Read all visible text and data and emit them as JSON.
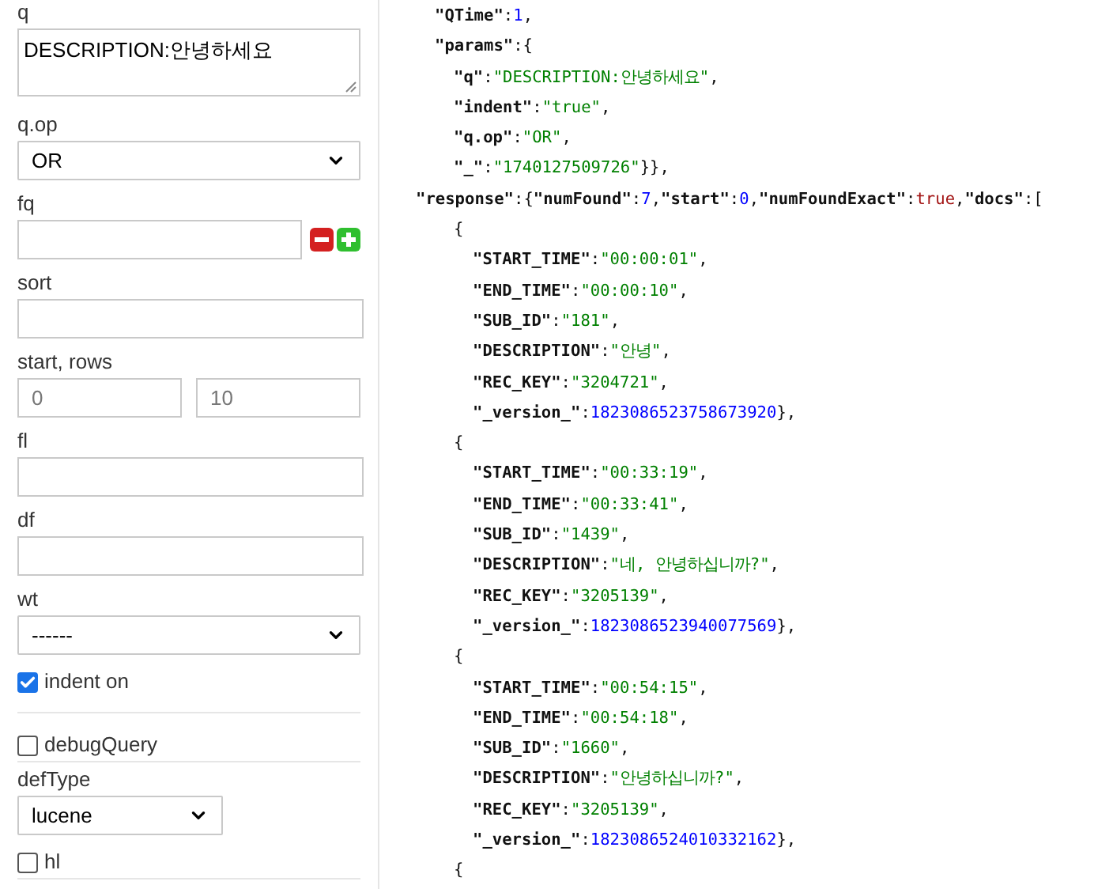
{
  "form": {
    "fields": [
      {
        "kind": "textarea",
        "label": "q",
        "value": "DESCRIPTION:안녕하세요"
      },
      {
        "kind": "select",
        "label": "q.op",
        "value": "OR",
        "wide": true
      },
      {
        "kind": "filter",
        "label": "fq"
      },
      {
        "kind": "input",
        "label": "sort"
      },
      {
        "kind": "pair",
        "label": "start, rows",
        "values": [
          "0",
          "10"
        ]
      },
      {
        "kind": "input",
        "label": "fl"
      },
      {
        "kind": "input",
        "label": "df"
      },
      {
        "kind": "select",
        "label": "wt",
        "value": "------",
        "wide": true
      },
      {
        "kind": "checkbox",
        "label": "indent on",
        "checked": true
      },
      {
        "kind": "checkbox",
        "label": "debugQuery",
        "checked": false
      },
      {
        "kind": "select",
        "label": "defType",
        "value": "lucene",
        "wide": false
      },
      {
        "kind": "checkbox",
        "label": "hl",
        "checked": false
      }
    ]
  },
  "response_view": {
    "lines": [
      {
        "children": [
          {
            "tokens": [
              {
                "kind": "key",
                "text": "\"QTime\""
              },
              {
                "kind": "punct",
                "text": ":"
              },
              {
                "kind": "number",
                "text": "1"
              },
              {
                "kind": "punct",
                "text": ","
              }
            ]
          },
          {
            "tokens": [
              {
                "kind": "key",
                "text": "\"params\""
              },
              {
                "kind": "punct",
                "text": ":{"
              }
            ],
            "children": [
              {
                "tokens": [
                  {
                    "kind": "key",
                    "text": "\"q\""
                  },
                  {
                    "kind": "punct",
                    "text": ":"
                  },
                  {
                    "kind": "string",
                    "text": "\"DESCRIPTION:안녕하세요\""
                  },
                  {
                    "kind": "punct",
                    "text": ","
                  }
                ]
              },
              {
                "tokens": [
                  {
                    "kind": "key",
                    "text": "\"indent\""
                  },
                  {
                    "kind": "punct",
                    "text": ":"
                  },
                  {
                    "kind": "string",
                    "text": "\"true\""
                  },
                  {
                    "kind": "punct",
                    "text": ","
                  }
                ]
              },
              {
                "tokens": [
                  {
                    "kind": "key",
                    "text": "\"q.op\""
                  },
                  {
                    "kind": "punct",
                    "text": ":"
                  },
                  {
                    "kind": "string",
                    "text": "\"OR\""
                  },
                  {
                    "kind": "punct",
                    "text": ","
                  }
                ]
              },
              {
                "tokens": [
                  {
                    "kind": "key",
                    "text": "\"_\""
                  },
                  {
                    "kind": "punct",
                    "text": ":"
                  },
                  {
                    "kind": "string",
                    "text": "\"1740127509726\""
                  },
                  {
                    "kind": "punct",
                    "text": "}},"
                  }
                ]
              }
            ]
          }
        ]
      },
      {
        "tokens": [
          {
            "kind": "key",
            "text": "\"response\""
          },
          {
            "kind": "punct",
            "text": ":{"
          },
          {
            "kind": "key",
            "text": "\"numFound\""
          },
          {
            "kind": "punct",
            "text": ":"
          },
          {
            "kind": "number",
            "text": "7"
          },
          {
            "kind": "punct",
            "text": ","
          },
          {
            "kind": "key",
            "text": "\"start\""
          },
          {
            "kind": "punct",
            "text": ":"
          },
          {
            "kind": "number",
            "text": "0"
          },
          {
            "kind": "punct",
            "text": ","
          },
          {
            "kind": "key",
            "text": "\"numFoundExact\""
          },
          {
            "kind": "punct",
            "text": ":"
          },
          {
            "kind": "bool",
            "text": "true"
          },
          {
            "kind": "punct",
            "text": ","
          },
          {
            "kind": "key",
            "text": "\"docs\""
          },
          {
            "kind": "punct",
            "text": ":["
          }
        ],
        "children": [
          {
            "children": [
              {
                "tokens": [
                  {
                    "kind": "punct",
                    "text": "{"
                  }
                ],
                "children": [
                  {
                    "tokens": [
                      {
                        "kind": "key",
                        "text": "\"START_TIME\""
                      },
                      {
                        "kind": "punct",
                        "text": ":"
                      },
                      {
                        "kind": "string",
                        "text": "\"00:00:01\""
                      },
                      {
                        "kind": "punct",
                        "text": ","
                      }
                    ]
                  },
                  {
                    "tokens": [
                      {
                        "kind": "key",
                        "text": "\"END_TIME\""
                      },
                      {
                        "kind": "punct",
                        "text": ":"
                      },
                      {
                        "kind": "string",
                        "text": "\"00:00:10\""
                      },
                      {
                        "kind": "punct",
                        "text": ","
                      }
                    ]
                  },
                  {
                    "tokens": [
                      {
                        "kind": "key",
                        "text": "\"SUB_ID\""
                      },
                      {
                        "kind": "punct",
                        "text": ":"
                      },
                      {
                        "kind": "string",
                        "text": "\"181\""
                      },
                      {
                        "kind": "punct",
                        "text": ","
                      }
                    ]
                  },
                  {
                    "tokens": [
                      {
                        "kind": "key",
                        "text": "\"DESCRIPTION\""
                      },
                      {
                        "kind": "punct",
                        "text": ":"
                      },
                      {
                        "kind": "string",
                        "text": "\"안녕\""
                      },
                      {
                        "kind": "punct",
                        "text": ","
                      }
                    ]
                  },
                  {
                    "tokens": [
                      {
                        "kind": "key",
                        "text": "\"REC_KEY\""
                      },
                      {
                        "kind": "punct",
                        "text": ":"
                      },
                      {
                        "kind": "string",
                        "text": "\"3204721\""
                      },
                      {
                        "kind": "punct",
                        "text": ","
                      }
                    ]
                  },
                  {
                    "tokens": [
                      {
                        "kind": "key",
                        "text": "\"_version_\""
                      },
                      {
                        "kind": "punct",
                        "text": ":"
                      },
                      {
                        "kind": "number",
                        "text": "1823086523758673920"
                      },
                      {
                        "kind": "punct",
                        "text": "},"
                      }
                    ]
                  }
                ]
              },
              {
                "tokens": [
                  {
                    "kind": "punct",
                    "text": "{"
                  }
                ],
                "children": [
                  {
                    "tokens": [
                      {
                        "kind": "key",
                        "text": "\"START_TIME\""
                      },
                      {
                        "kind": "punct",
                        "text": ":"
                      },
                      {
                        "kind": "string",
                        "text": "\"00:33:19\""
                      },
                      {
                        "kind": "punct",
                        "text": ","
                      }
                    ]
                  },
                  {
                    "tokens": [
                      {
                        "kind": "key",
                        "text": "\"END_TIME\""
                      },
                      {
                        "kind": "punct",
                        "text": ":"
                      },
                      {
                        "kind": "string",
                        "text": "\"00:33:41\""
                      },
                      {
                        "kind": "punct",
                        "text": ","
                      }
                    ]
                  },
                  {
                    "tokens": [
                      {
                        "kind": "key",
                        "text": "\"SUB_ID\""
                      },
                      {
                        "kind": "punct",
                        "text": ":"
                      },
                      {
                        "kind": "string",
                        "text": "\"1439\""
                      },
                      {
                        "kind": "punct",
                        "text": ","
                      }
                    ]
                  },
                  {
                    "tokens": [
                      {
                        "kind": "key",
                        "text": "\"DESCRIPTION\""
                      },
                      {
                        "kind": "punct",
                        "text": ":"
                      },
                      {
                        "kind": "string",
                        "text": "\"네, 안녕하십니까?\""
                      },
                      {
                        "kind": "punct",
                        "text": ","
                      }
                    ]
                  },
                  {
                    "tokens": [
                      {
                        "kind": "key",
                        "text": "\"REC_KEY\""
                      },
                      {
                        "kind": "punct",
                        "text": ":"
                      },
                      {
                        "kind": "string",
                        "text": "\"3205139\""
                      },
                      {
                        "kind": "punct",
                        "text": ","
                      }
                    ]
                  },
                  {
                    "tokens": [
                      {
                        "kind": "key",
                        "text": "\"_version_\""
                      },
                      {
                        "kind": "punct",
                        "text": ":"
                      },
                      {
                        "kind": "number",
                        "text": "1823086523940077569"
                      },
                      {
                        "kind": "punct",
                        "text": "},"
                      }
                    ]
                  }
                ]
              },
              {
                "tokens": [
                  {
                    "kind": "punct",
                    "text": "{"
                  }
                ],
                "children": [
                  {
                    "tokens": [
                      {
                        "kind": "key",
                        "text": "\"START_TIME\""
                      },
                      {
                        "kind": "punct",
                        "text": ":"
                      },
                      {
                        "kind": "string",
                        "text": "\"00:54:15\""
                      },
                      {
                        "kind": "punct",
                        "text": ","
                      }
                    ]
                  },
                  {
                    "tokens": [
                      {
                        "kind": "key",
                        "text": "\"END_TIME\""
                      },
                      {
                        "kind": "punct",
                        "text": ":"
                      },
                      {
                        "kind": "string",
                        "text": "\"00:54:18\""
                      },
                      {
                        "kind": "punct",
                        "text": ","
                      }
                    ]
                  },
                  {
                    "tokens": [
                      {
                        "kind": "key",
                        "text": "\"SUB_ID\""
                      },
                      {
                        "kind": "punct",
                        "text": ":"
                      },
                      {
                        "kind": "string",
                        "text": "\"1660\""
                      },
                      {
                        "kind": "punct",
                        "text": ","
                      }
                    ]
                  },
                  {
                    "tokens": [
                      {
                        "kind": "key",
                        "text": "\"DESCRIPTION\""
                      },
                      {
                        "kind": "punct",
                        "text": ":"
                      },
                      {
                        "kind": "string",
                        "text": "\"안녕하십니까?\""
                      },
                      {
                        "kind": "punct",
                        "text": ","
                      }
                    ]
                  },
                  {
                    "tokens": [
                      {
                        "kind": "key",
                        "text": "\"REC_KEY\""
                      },
                      {
                        "kind": "punct",
                        "text": ":"
                      },
                      {
                        "kind": "string",
                        "text": "\"3205139\""
                      },
                      {
                        "kind": "punct",
                        "text": ","
                      }
                    ]
                  },
                  {
                    "tokens": [
                      {
                        "kind": "key",
                        "text": "\"_version_\""
                      },
                      {
                        "kind": "punct",
                        "text": ":"
                      },
                      {
                        "kind": "number",
                        "text": "1823086524010332162"
                      },
                      {
                        "kind": "punct",
                        "text": "},"
                      }
                    ]
                  }
                ]
              },
              {
                "tokens": [
                  {
                    "kind": "punct",
                    "text": "{"
                  }
                ]
              }
            ]
          }
        ]
      }
    ]
  }
}
